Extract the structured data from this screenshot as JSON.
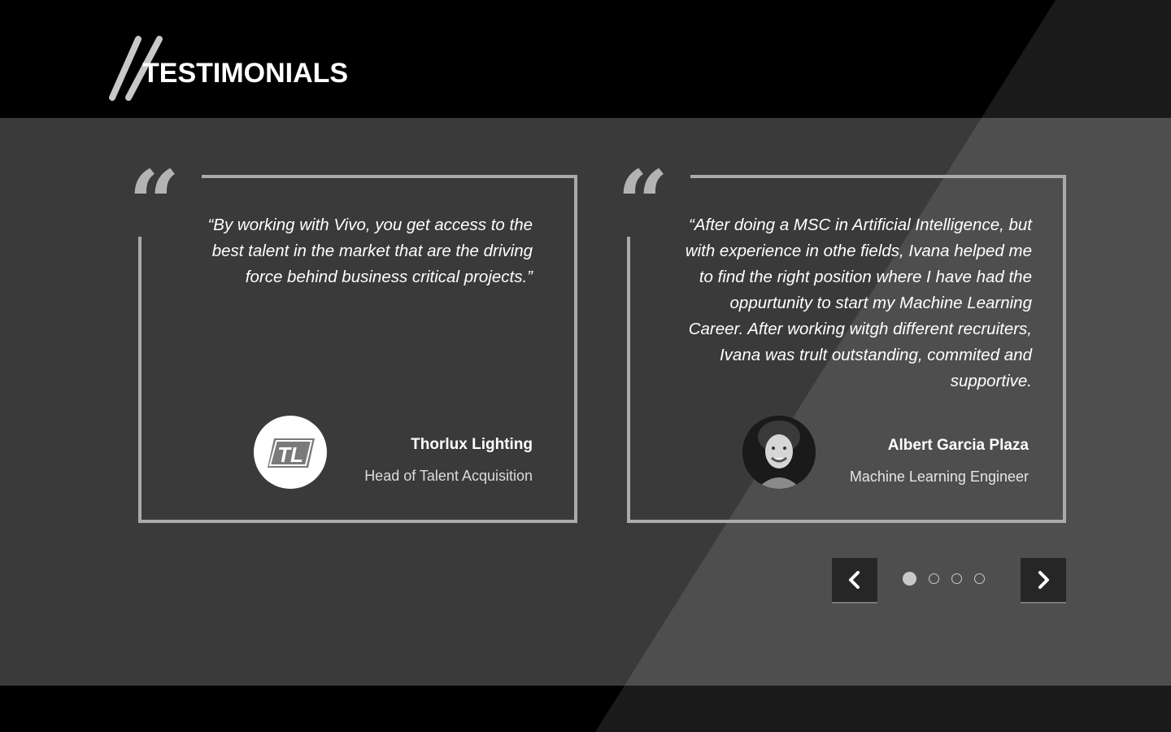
{
  "header": {
    "title": "TESTIMONIALS"
  },
  "testimonials": [
    {
      "quote_mark": "“",
      "quote": "“By working with Vivo, you get access to the best talent in the market that are the driving force behind business critical projects.”",
      "name": "Thorlux Lighting",
      "role": "Head of Talent Acquisition",
      "avatar": {
        "type": "logo",
        "text": "TL"
      }
    },
    {
      "quote_mark": "“",
      "quote": "“After doing a MSC in Artificial Intelligence, but with experience in othe fields, Ivana helped me to find the right position where I have had the oppurtunity to start my Machine Learning Career. After working witgh different recruiters, Ivana was trult outstanding, commited and supportive.",
      "name": "Albert Garcia Plaza",
      "role": "Machine Learning Engineer",
      "avatar": {
        "type": "photo"
      }
    }
  ],
  "carousel": {
    "prev_icon": "chevron-left-icon",
    "next_icon": "chevron-right-icon",
    "page_count": 4,
    "active_index": 0
  },
  "colors": {
    "background": "#000000",
    "band": "#3a3a3a",
    "accent_gray": "#b3b3b3",
    "text": "#ffffff"
  }
}
